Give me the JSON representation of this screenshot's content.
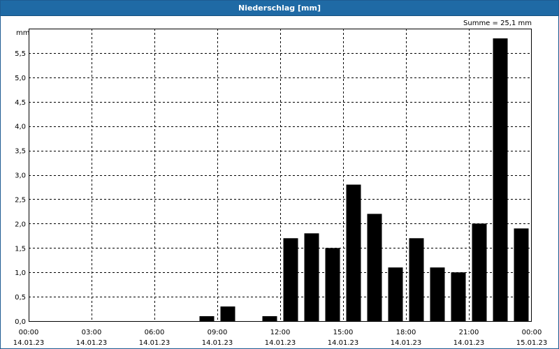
{
  "window": {
    "title": "Niederschlag [mm]"
  },
  "colors": {
    "title_bar": "#1f6aa5",
    "bar": "#000000",
    "grid": "#000000"
  },
  "chart_data": {
    "type": "bar",
    "title": "Niederschlag [mm]",
    "ylabel": "mm",
    "annotation": "Summe = 25,1 mm",
    "ylim": [
      0,
      6.0
    ],
    "yticks": [
      "0,0",
      "0,5",
      "1,0",
      "1,5",
      "2,0",
      "2,5",
      "3,0",
      "3,5",
      "4,0",
      "4,5",
      "5,0",
      "5,5"
    ],
    "xticks": [
      {
        "time": "00:00",
        "date": "14.01.23"
      },
      {
        "time": "03:00",
        "date": "14.01.23"
      },
      {
        "time": "06:00",
        "date": "14.01.23"
      },
      {
        "time": "09:00",
        "date": "14.01.23"
      },
      {
        "time": "12:00",
        "date": "14.01.23"
      },
      {
        "time": "15:00",
        "date": "14.01.23"
      },
      {
        "time": "18:00",
        "date": "14.01.23"
      },
      {
        "time": "21:00",
        "date": "14.01.23"
      },
      {
        "time": "00:00",
        "date": "15.01.23"
      }
    ],
    "grid": true,
    "categories": [
      "00:00",
      "01:00",
      "02:00",
      "03:00",
      "04:00",
      "05:00",
      "06:00",
      "07:00",
      "08:00",
      "09:00",
      "10:00",
      "11:00",
      "12:00",
      "13:00",
      "14:00",
      "15:00",
      "16:00",
      "17:00",
      "18:00",
      "19:00",
      "20:00",
      "21:00",
      "22:00",
      "23:00"
    ],
    "values": [
      0,
      0,
      0,
      0,
      0,
      0,
      0,
      0,
      0.1,
      0.3,
      0,
      0.1,
      1.7,
      1.8,
      1.5,
      2.8,
      2.2,
      1.1,
      1.7,
      1.1,
      1.0,
      2.0,
      5.8,
      1.9
    ]
  }
}
